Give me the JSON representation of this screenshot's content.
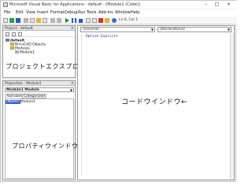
{
  "window": {
    "title": "Microsoft Visual Basic for Applications - default - [Module1 (Code)]",
    "minimize": "–",
    "maximize": "□",
    "close": "×"
  },
  "menu": [
    "File",
    "Edit",
    "View",
    "Insert",
    "Format",
    "Debug",
    "Run",
    "Tools",
    "Add-Ins",
    "Window",
    "Help"
  ],
  "toolbar": {
    "cursor_status": "Ln 6, Col 1"
  },
  "project_pane": {
    "title": "Project - default",
    "close": "×",
    "tree": [
      "default",
      "BricsCAD Objects",
      "Modules",
      "Module1"
    ],
    "note": "プロジェクトエクスプローラ←"
  },
  "properties_pane": {
    "title": "Properties - Module1",
    "close": "×",
    "object_selector": "Module1 Module",
    "tabs": [
      "Alphabetic",
      "Categorized"
    ],
    "row_name_key": "(Name)",
    "row_name_value": "Module1",
    "note": "プロパティウインドウ←"
  },
  "code_window": {
    "object_combo": "(General)",
    "procedure_combo": "(Declarations)",
    "code": "Option Explicit",
    "note": "コードウインドウ←"
  }
}
